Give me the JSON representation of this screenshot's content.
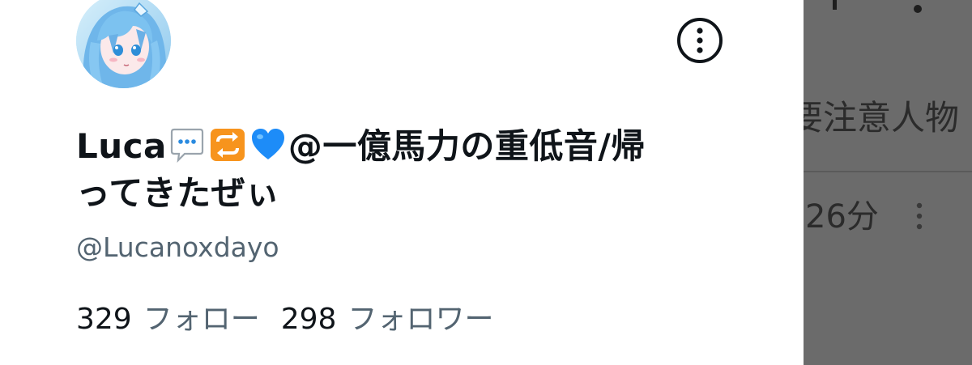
{
  "profile": {
    "name_prefix": "Luca",
    "name_suffix": "@一億馬力の重低音/帰ってきたぜぃ",
    "name_emojis": [
      "speech-balloon-emoji",
      "repeat-emoji",
      "blue-heart-emoji"
    ],
    "handle": "@Lucanoxdayo",
    "following_count": "329",
    "following_label": "フォロー",
    "followers_count": "298",
    "followers_label": "フォロワー",
    "more_icon": "more-vertical-circle-icon"
  },
  "backdrop": {
    "title_fragment": "要注意人物",
    "time_fragment": "26分",
    "more_icon": "more-vertical-icon"
  },
  "colors": {
    "text_primary": "#0f1419",
    "text_secondary": "#536471",
    "overlay": "#6b6b6b",
    "heart_blue": "#1d8cf8",
    "repeat_orange": "#f7941d"
  }
}
